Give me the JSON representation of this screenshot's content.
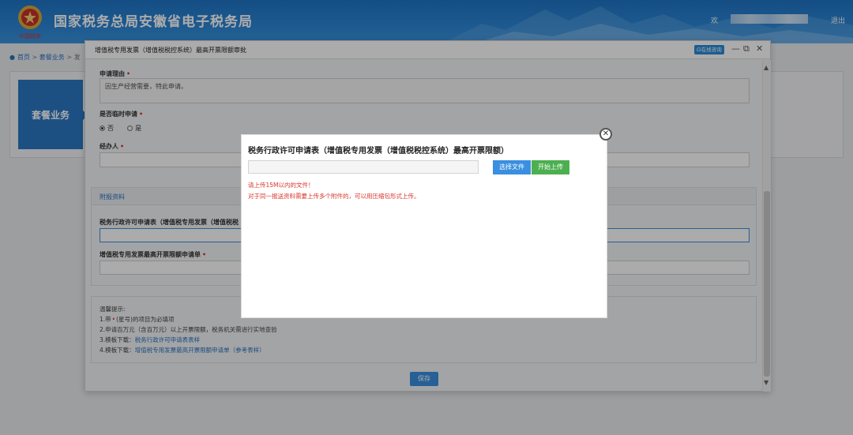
{
  "header": {
    "site_title": "国家税务总局安徽省电子税务局",
    "emblem_text": "中国税务",
    "welcome": "欢",
    "logout": "退出"
  },
  "breadcrumb": {
    "home": "首页",
    "sep1": ">",
    "package": "套餐业务",
    "sep2": ">",
    "more": "发"
  },
  "background": {
    "package_label": "套餐业务"
  },
  "dialog": {
    "title": "增值税专用发票（增值税税控系统）最高开票限额审批",
    "online_consult": "在线咨询",
    "minimize": "—",
    "maximize": "⧉",
    "close": "✕",
    "reason_label": "申请理由",
    "reason_value": "因生产经营需要，特此申请。",
    "temporary_label": "是否临时申请",
    "radio_no": "否",
    "radio_yes": "是",
    "agent_label": "经办人",
    "attachments_title": "附报资料",
    "attach1_label": "税务行政许可申请表（增值税专用发票（增值税税",
    "attach2_label": "增值税专用发票最高开票限额申请单",
    "tips_title": "温馨提示:",
    "tip1_a": "1.带",
    "tip1_b": "(星号)的项目为必填项",
    "tip2": "2.申请百万元（含百万元）以上开票限额，税务机关需进行实地查验",
    "tip3_prefix": "3.模板下载：",
    "tip3_link": "税务行政许可申请表表样",
    "tip4_prefix": "4.模板下载：",
    "tip4_link": "增值税专用发票最高开票限额申请单（参考表样）",
    "save": "保存"
  },
  "modal": {
    "title": "税务行政许可申请表（增值税专用发票（增值税税控系统）最高开票限额）",
    "choose_file": "选择文件",
    "start_upload": "开始上传",
    "warn1": "请上传15M以内的文件！",
    "warn2": "对于同一报送资料需要上传多个附件的，可以用压缩包形式上传。",
    "close": "✕"
  },
  "colors": {
    "header_blue": "#2b86d6",
    "primary_button": "#3a8fe0",
    "upload_button": "#4caf50",
    "required_red": "#d9342b",
    "link_blue": "#2a72c1"
  }
}
